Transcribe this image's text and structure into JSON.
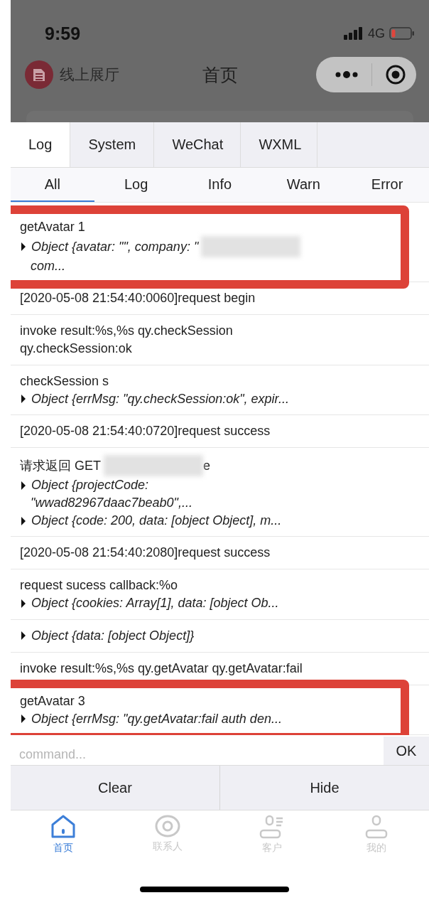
{
  "status_bar": {
    "time": "9:59",
    "network": "4G"
  },
  "nav": {
    "app_name": "线上展厅",
    "title": "首页"
  },
  "console": {
    "tabs": [
      {
        "label": "Log",
        "selected": true
      },
      {
        "label": "System",
        "selected": false
      },
      {
        "label": "WeChat",
        "selected": false
      },
      {
        "label": "WXML",
        "selected": false
      }
    ],
    "filters": [
      {
        "label": "All",
        "selected": true
      },
      {
        "label": "Log",
        "selected": false
      },
      {
        "label": "Info",
        "selected": false
      },
      {
        "label": "Warn",
        "selected": false
      },
      {
        "label": "Error",
        "selected": false
      }
    ],
    "entries": [
      {
        "highlighted": true,
        "lines": [
          {
            "kind": "text",
            "text": "getAvatar 1"
          },
          {
            "kind": "object",
            "text": "Object {avatar: \"\", company: \"",
            "redacted": true
          },
          {
            "kind": "cont",
            "text": "com..."
          }
        ]
      },
      {
        "highlighted": false,
        "lines": [
          {
            "kind": "text",
            "text": "[2020-05-08 21:54:40:0060]request begin"
          }
        ]
      },
      {
        "highlighted": false,
        "lines": [
          {
            "kind": "text",
            "text": "invoke result:%s,%s qy.checkSession"
          },
          {
            "kind": "text",
            "text": "qy.checkSession:ok"
          }
        ]
      },
      {
        "highlighted": false,
        "lines": [
          {
            "kind": "text",
            "text": "checkSession s"
          },
          {
            "kind": "object",
            "text": "Object {errMsg: \"qy.checkSession:ok\", expir..."
          }
        ]
      },
      {
        "highlighted": false,
        "lines": [
          {
            "kind": "text",
            "text": "[2020-05-08 21:54:40:0720]request success"
          }
        ]
      },
      {
        "highlighted": false,
        "lines": [
          {
            "kind": "text",
            "text": "请求返回 GET",
            "redacted": true,
            "tail": "e"
          },
          {
            "kind": "object",
            "text": "Object {projectCode:"
          },
          {
            "kind": "cont",
            "text": "\"wwad82967daac7beab0\",..."
          },
          {
            "kind": "object",
            "text": "Object {code: 200, data: [object Object], m..."
          }
        ]
      },
      {
        "highlighted": false,
        "lines": [
          {
            "kind": "text",
            "text": "[2020-05-08 21:54:40:2080]request success"
          }
        ]
      },
      {
        "highlighted": false,
        "lines": [
          {
            "kind": "text",
            "text": "request sucess callback:%o"
          },
          {
            "kind": "object",
            "text": "Object {cookies: Array[1], data: [object Ob..."
          }
        ]
      },
      {
        "highlighted": false,
        "lines": [
          {
            "kind": "object",
            "text": "Object {data: [object Object]}"
          }
        ]
      },
      {
        "highlighted": false,
        "lines": [
          {
            "kind": "text",
            "text": "invoke result:%s,%s qy.getAvatar qy.getAvatar:fail"
          }
        ]
      },
      {
        "highlighted": true,
        "lines": [
          {
            "kind": "text",
            "text": "getAvatar 3"
          },
          {
            "kind": "object",
            "text": "Object {errMsg: \"qy.getAvatar:fail auth den..."
          }
        ]
      }
    ],
    "command": {
      "placeholder": "command...",
      "button": "OK"
    },
    "actions": [
      "Clear",
      "Hide"
    ]
  },
  "tab_bar": [
    {
      "label": "首页",
      "kind": "home",
      "selected": true
    },
    {
      "label": "联系人",
      "kind": "eye",
      "selected": false
    },
    {
      "label": "客户",
      "kind": "client",
      "selected": false
    },
    {
      "label": "我的",
      "kind": "person",
      "selected": false
    }
  ]
}
